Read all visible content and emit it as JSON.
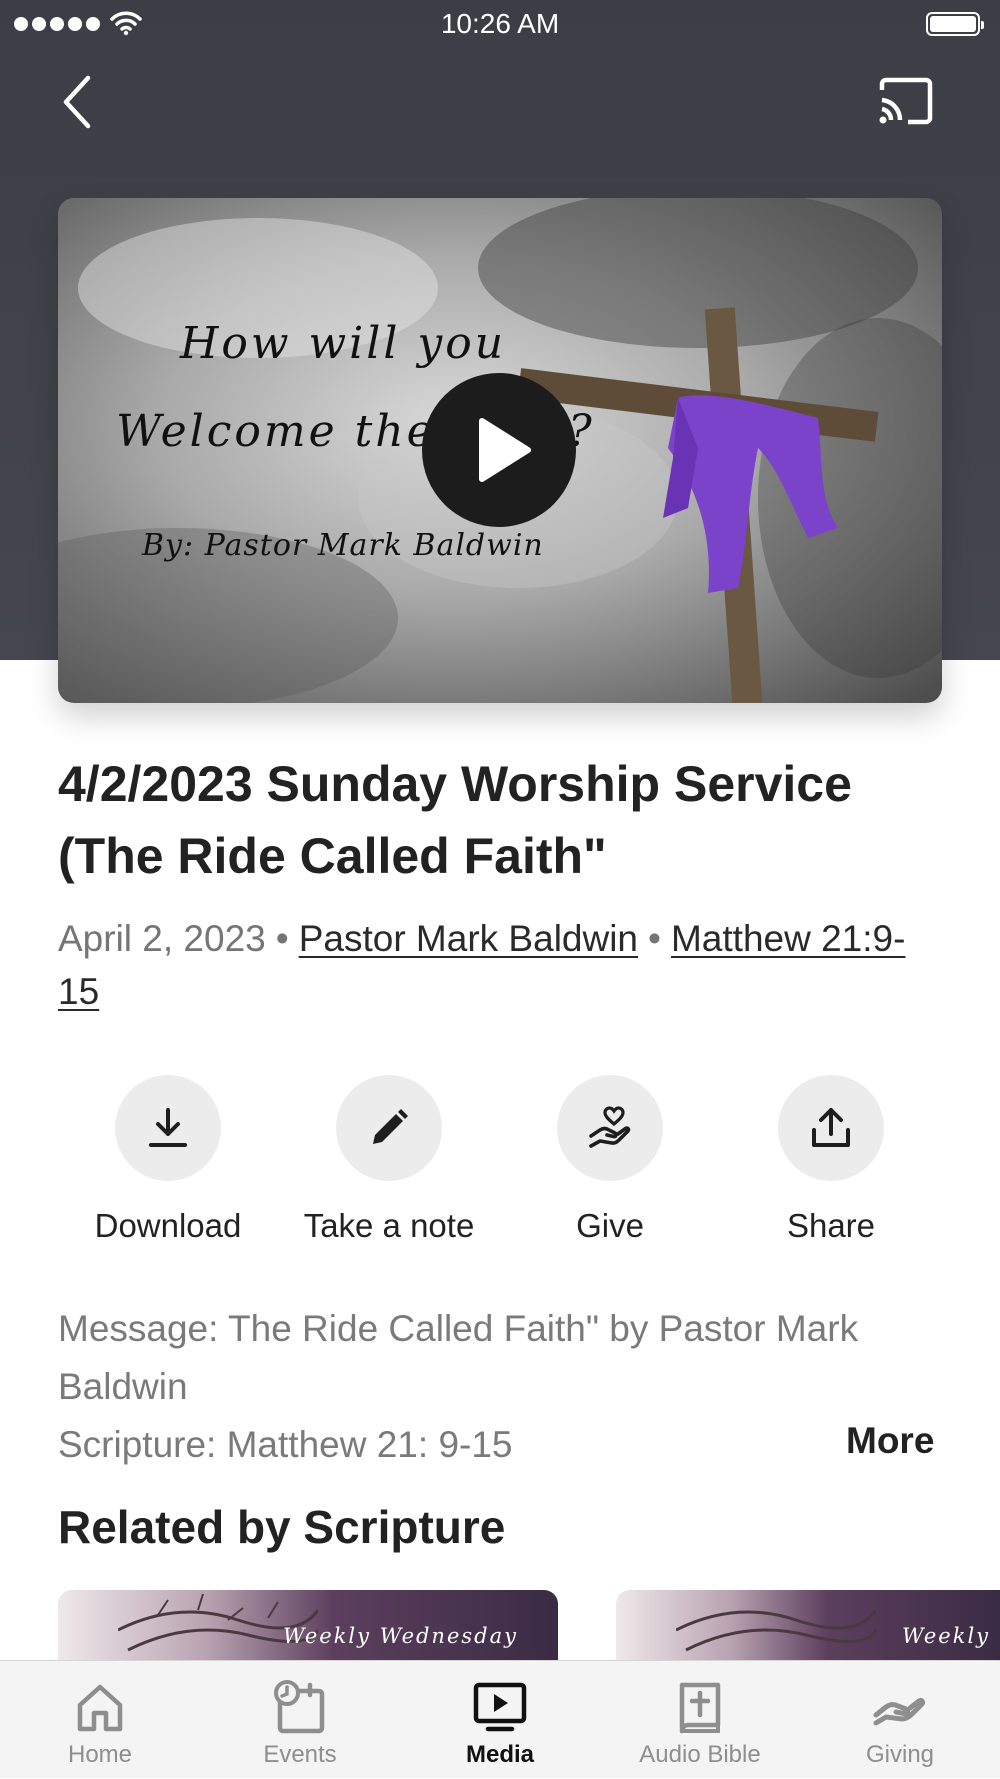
{
  "status_bar": {
    "time": "10:26 AM",
    "signal_icon": "signal-dots-icon",
    "wifi_icon": "wifi-icon",
    "battery_icon": "battery-icon"
  },
  "nav": {
    "back_icon": "chevron-left-icon",
    "cast_icon": "cast-icon"
  },
  "video": {
    "overlay_line1": "How will you",
    "overlay_line2": "Welcome the King?",
    "overlay_line3": "By: Pastor Mark Baldwin",
    "play_icon": "play-icon"
  },
  "sermon": {
    "title": "4/2/2023 Sunday Worship Service (The Ride Called Faith\"",
    "date": "April 2, 2023",
    "separator": "•",
    "speaker": "Pastor Mark Baldwin",
    "scripture_ref": "Matthew 21:9-15"
  },
  "actions": [
    {
      "label": "Download",
      "icon": "download-icon"
    },
    {
      "label": "Take a note",
      "icon": "pencil-icon"
    },
    {
      "label": "Give",
      "icon": "give-heart-hand-icon"
    },
    {
      "label": "Share",
      "icon": "share-icon"
    }
  ],
  "description": {
    "message_line": "Message: The Ride Called Faith\" by Pastor Mark Baldwin",
    "scripture_line": "Scripture: Matthew 21: 9-15",
    "more_label": "More"
  },
  "related": {
    "title": "Related by Scripture",
    "cards": [
      {
        "text": "Weekly Wednesday"
      },
      {
        "text": "Weekly We"
      }
    ]
  },
  "tabs": [
    {
      "label": "Home",
      "icon": "home-icon",
      "active": false
    },
    {
      "label": "Events",
      "icon": "calendar-clock-icon",
      "active": false
    },
    {
      "label": "Media",
      "icon": "tv-play-icon",
      "active": true
    },
    {
      "label": "Audio Bible",
      "icon": "bible-icon",
      "active": false
    },
    {
      "label": "Giving",
      "icon": "giving-hand-icon",
      "active": false
    }
  ]
}
